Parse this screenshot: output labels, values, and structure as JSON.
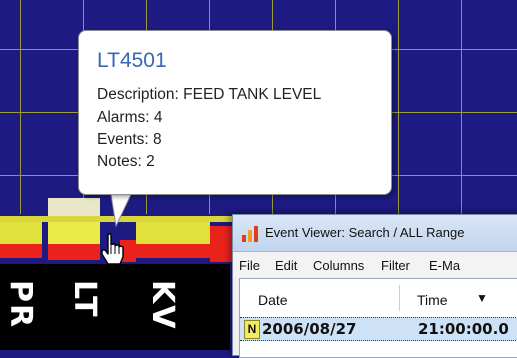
{
  "tooltip": {
    "title": "LT4501",
    "lines": [
      "Description: FEED TANK LEVEL",
      "Alarms: 4",
      "Events: 8",
      "Notes: 2"
    ]
  },
  "tag_labels": [
    "PR",
    "LT",
    "KV"
  ],
  "event_viewer": {
    "title": "Event Viewer: Search / ALL  Range",
    "menu": [
      "File",
      "Edit",
      "Columns",
      "Filter",
      "E-Ma"
    ],
    "columns": [
      "Date",
      "Time"
    ],
    "sort_indicator": "▼",
    "rows": [
      {
        "badge": "N",
        "date": "2006/08/27",
        "time": "21:00:00.0"
      }
    ]
  },
  "colors": {
    "background": "#1d1a82",
    "gridline": "#9c9a3a",
    "bar_yellow": "#e2e03a",
    "bar_red": "#e9231c",
    "tooltip_title": "#3a67b4",
    "selected_row": "#cde2f7"
  },
  "icons": [
    "hand-pointer-icon",
    "bar-chart-app-icon",
    "sort-descending-icon"
  ]
}
